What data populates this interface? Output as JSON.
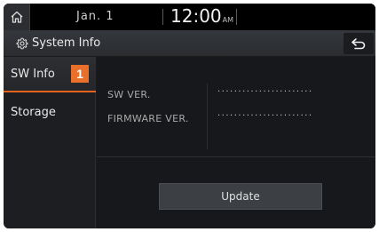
{
  "statusbar": {
    "home_icon": "home-icon",
    "date": "Jan.  1",
    "time": "12:00",
    "ampm": "AM"
  },
  "titlebar": {
    "settings_icon": "gear-icon",
    "title": "System Info",
    "back_icon": "back-arrow-icon"
  },
  "sidebar": {
    "items": [
      {
        "label": "SW Info",
        "badge": "1",
        "active": true
      },
      {
        "label": "Storage",
        "active": false
      }
    ]
  },
  "info": {
    "rows": [
      {
        "label": "SW VER.",
        "value": "·······················"
      },
      {
        "label": "FIRMWARE VER.",
        "value": "·······················"
      }
    ]
  },
  "update_button": "Update",
  "colors": {
    "accent": "#e8702a",
    "background": "#181a1d"
  }
}
